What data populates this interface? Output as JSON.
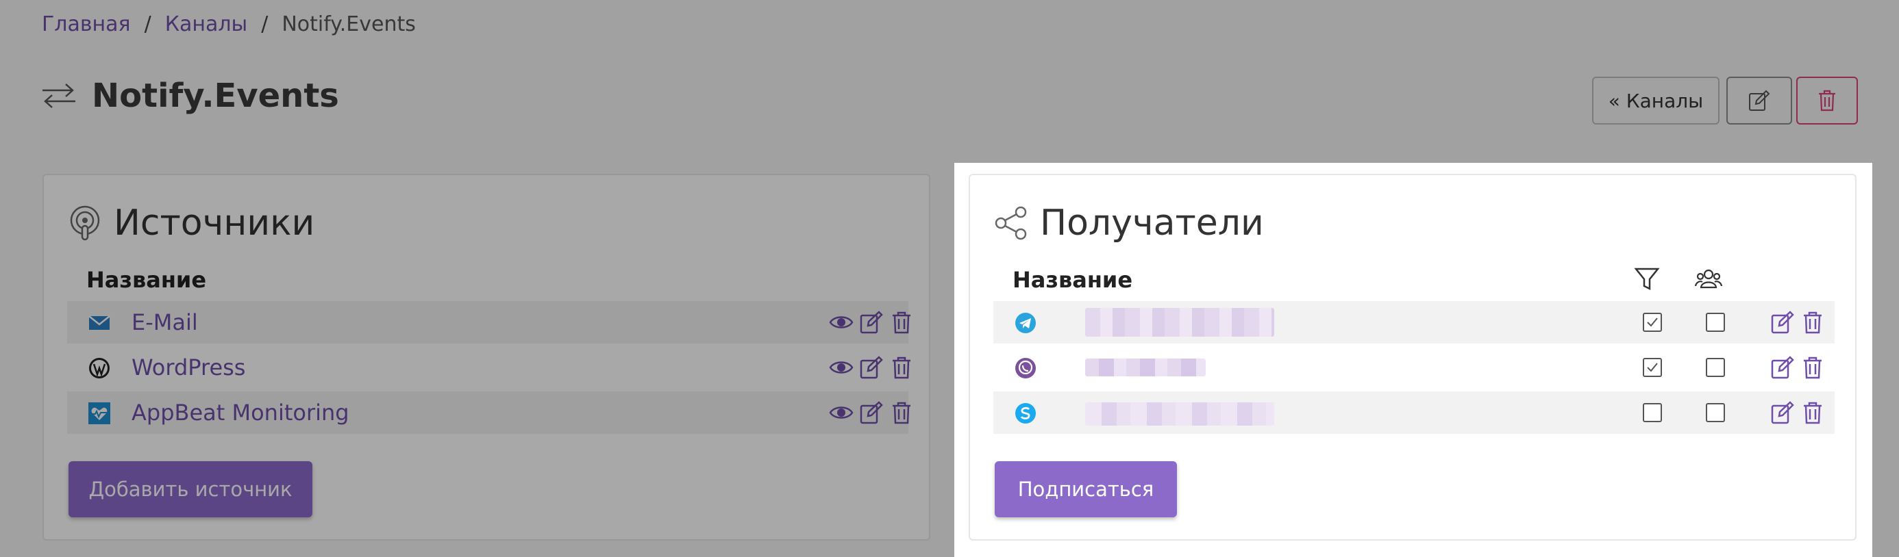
{
  "breadcrumb": {
    "items": [
      "Главная",
      "Каналы",
      "Notify.Events"
    ],
    "separator": "/"
  },
  "page": {
    "title": "Notify.Events",
    "back_button": "« Каналы"
  },
  "sources": {
    "title": "Источники",
    "column_name": "Название",
    "items": [
      {
        "label": "E-Mail",
        "icon": "email-icon"
      },
      {
        "label": "WordPress",
        "icon": "wordpress-icon"
      },
      {
        "label": "AppBeat Monitoring",
        "icon": "appbeat-icon"
      }
    ],
    "add_button": "Добавить источник"
  },
  "recipients": {
    "title": "Получатели",
    "column_name": "Название",
    "column_filter_icon": "filter-icon",
    "column_group_icon": "group-icon",
    "items": [
      {
        "icon": "telegram-icon",
        "filter": true,
        "group": false
      },
      {
        "icon": "viber-icon",
        "filter": true,
        "group": false
      },
      {
        "icon": "skype-icon",
        "filter": false,
        "group": false
      }
    ],
    "subscribe_button": "Подписаться"
  },
  "colors": {
    "accent": "#6f4ea8",
    "button": "#8b6ac9",
    "danger": "#d9407a",
    "telegram": "#2aa3df",
    "viber": "#7b519d",
    "skype": "#1ba9f0"
  }
}
